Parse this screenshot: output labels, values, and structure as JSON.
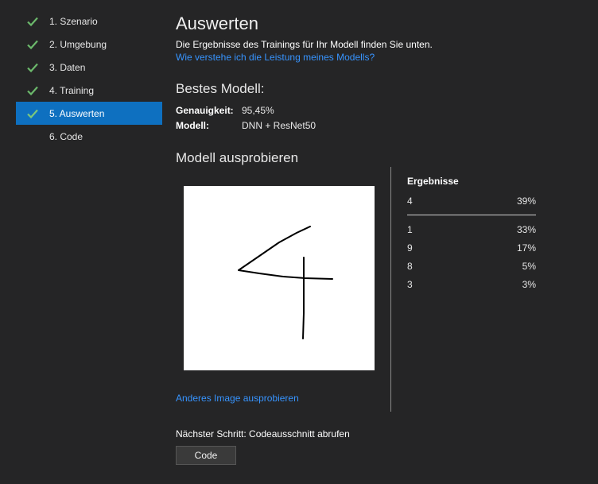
{
  "sidebar": {
    "items": [
      {
        "label": "1. Szenario",
        "done": true
      },
      {
        "label": "2. Umgebung",
        "done": true
      },
      {
        "label": "3. Daten",
        "done": true
      },
      {
        "label": "4. Training",
        "done": true
      },
      {
        "label": "5. Auswerten",
        "done": true,
        "active": true
      },
      {
        "label": "6. Code",
        "done": false
      }
    ]
  },
  "main": {
    "title": "Auswerten",
    "description": "Die Ergebnisse des Trainings für Ihr Modell finden Sie unten.",
    "help_link": "Wie verstehe ich die Leistung meines Modells?",
    "best_model": {
      "title": "Bestes Modell:",
      "accuracy_label": "Genauigkeit:",
      "accuracy_value": "95,45%",
      "model_label": "Modell:",
      "model_value": "DNN + ResNet50"
    },
    "try_model": {
      "title": "Modell ausprobieren",
      "other_image_link": "Anderes Image ausprobieren"
    },
    "results": {
      "header": "Ergebnisse",
      "top": {
        "label": "4",
        "value": "39%"
      },
      "rows": [
        {
          "label": "1",
          "value": "33%"
        },
        {
          "label": "9",
          "value": "17%"
        },
        {
          "label": "8",
          "value": "5%"
        },
        {
          "label": "3",
          "value": "3%"
        }
      ]
    },
    "next_step": "Nächster Schritt: Codeausschnitt abrufen",
    "code_button": "Code"
  },
  "colors": {
    "background": "#252526",
    "active": "#0e70c0",
    "link": "#3794ff",
    "check": "#6bb86b"
  },
  "icons": {
    "step_done": "check-icon"
  }
}
